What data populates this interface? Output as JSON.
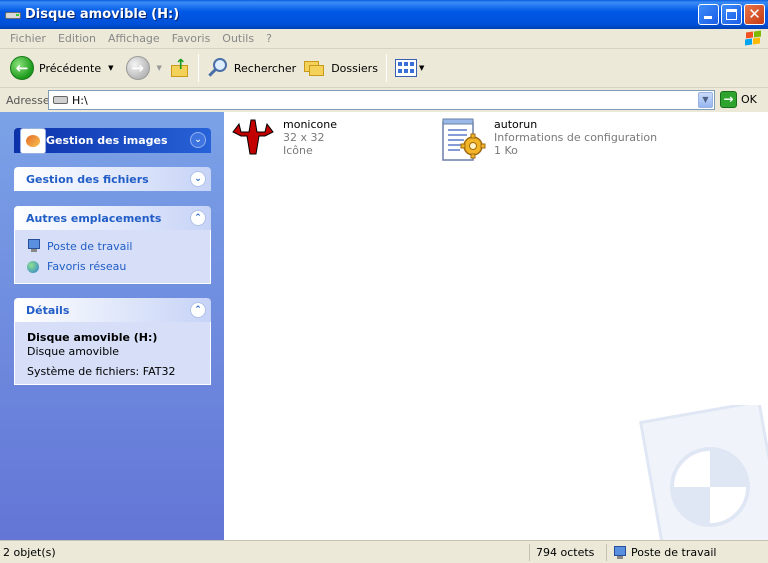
{
  "window": {
    "title": "Disque amovible (H:)"
  },
  "menu": {
    "items": [
      "Fichier",
      "Edition",
      "Affichage",
      "Favoris",
      "Outils",
      "?"
    ]
  },
  "toolbar": {
    "back_label": "Précédente",
    "search_label": "Rechercher",
    "folders_label": "Dossiers"
  },
  "address": {
    "label": "Adresse",
    "value": "H:\\",
    "go_label": "OK"
  },
  "taskpane": {
    "images": {
      "title": "Gestion des images"
    },
    "files": {
      "title": "Gestion des fichiers"
    },
    "places": {
      "title": "Autres emplacements",
      "links": [
        "Poste de travail",
        "Favoris réseau"
      ]
    },
    "details": {
      "title": "Détails",
      "name": "Disque amovible (H:)",
      "type": "Disque amovible",
      "fs": "Système de fichiers: FAT32"
    }
  },
  "files": [
    {
      "name": "monicone",
      "line1": "32 x 32",
      "line2": "Icône"
    },
    {
      "name": "autorun",
      "line1": "Informations de configuration",
      "line2": "1 Ko"
    }
  ],
  "status": {
    "count": "2 objet(s)",
    "size": "794 octets",
    "location": "Poste de travail"
  },
  "colors": {
    "titlebar": "#0058e6",
    "taskpane_top": "#7ba2e7",
    "taskpane_bottom": "#6375d6",
    "link": "#215dc6",
    "chrome": "#ece9d8"
  }
}
